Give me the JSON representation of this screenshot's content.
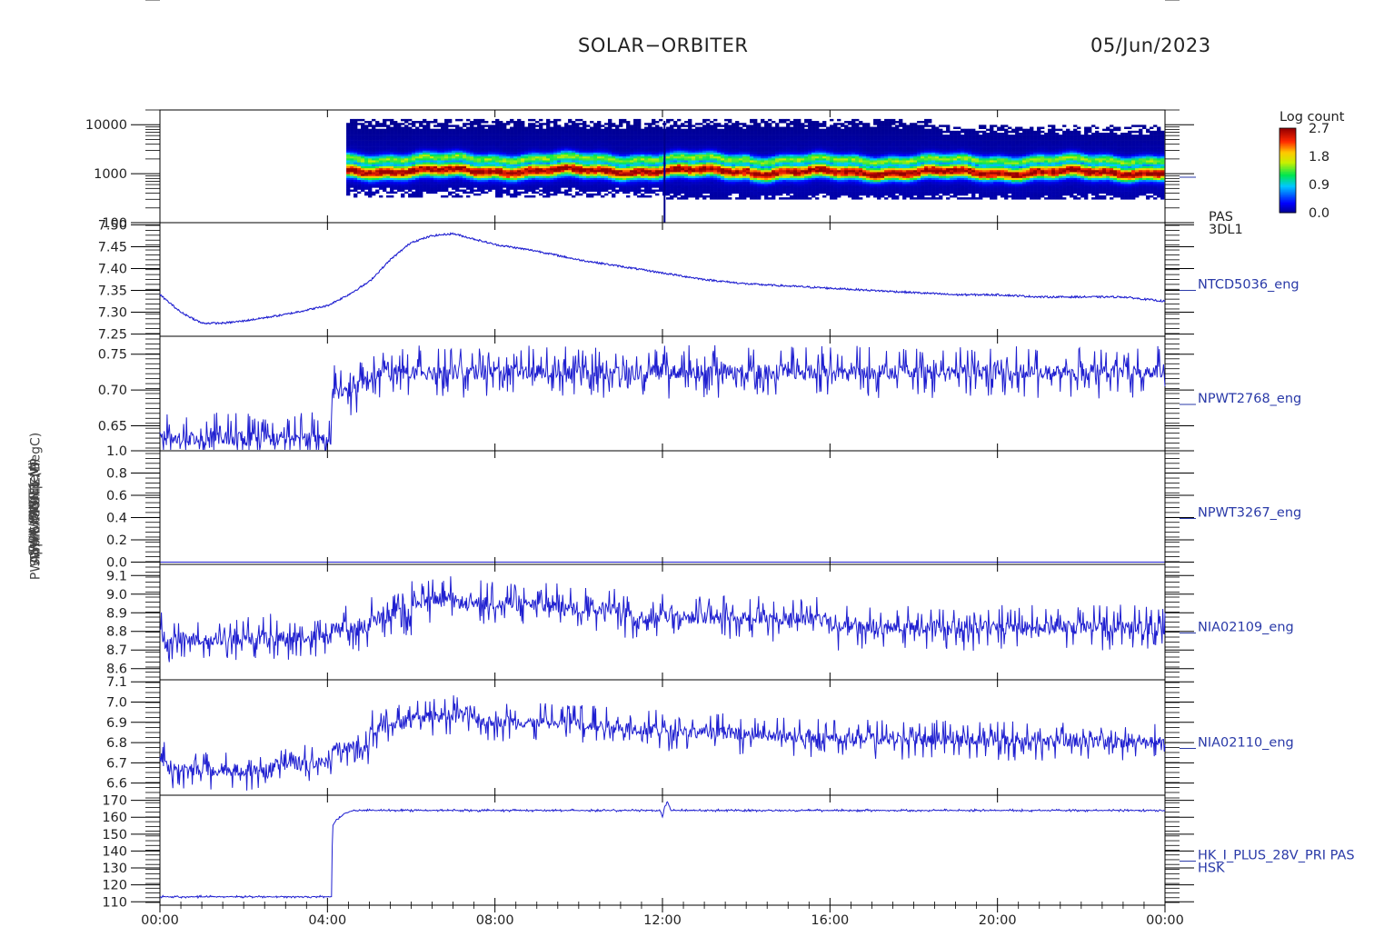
{
  "header": {
    "mission": "SOLAR−ORBITER",
    "date": "05/Jun/2023"
  },
  "colorbar": {
    "label": "Log count",
    "ticks": [
      "2.7",
      "1.8",
      "0.9",
      "0.0"
    ]
  },
  "x_axis": {
    "tick_labels": [
      "00:00",
      "04:00",
      "08:00",
      "12:00",
      "16:00",
      "20:00",
      "00:00"
    ]
  },
  "y_title_lines": [
    "SW E(eV)",
    "Approx Temp (DegC)",
    "RPW ANT 1 (A)",
    "SWA EAS 0 TEMP",
    "SWA PAS ...",
    "PWR HK IMON ..."
  ],
  "colors": {
    "line": "#1f1fd0",
    "axis": "#000000",
    "label": "#2a3aa8"
  },
  "chart_data": [
    {
      "type": "heatmap",
      "name": "PAS 3DL1",
      "right_labels": [
        "PAS",
        "3DL1"
      ],
      "y_scale": "log",
      "ylim": [
        100,
        20000
      ],
      "y_ticks": [
        "10000",
        "1000",
        "100"
      ],
      "data_start_hour": 4.45,
      "peak_energy_ev": 1100,
      "color_scale": {
        "label": "Log count",
        "min": 0.0,
        "max": 2.7
      }
    },
    {
      "type": "line",
      "name": "NTCD5036_eng",
      "right_labels": [
        "NTCD5036_eng"
      ],
      "ylim": [
        7.245,
        7.505
      ],
      "y_ticks": [
        "7.50",
        "7.45",
        "7.40",
        "7.35",
        "7.30",
        "7.25"
      ],
      "x": [
        0,
        0.5,
        1,
        1.5,
        2,
        3,
        4,
        4.5,
        5,
        5.5,
        6,
        6.5,
        7,
        8,
        9,
        10,
        11,
        12,
        13,
        14,
        15,
        16,
        17,
        18,
        19,
        20,
        21,
        22,
        23,
        24
      ],
      "y": [
        7.34,
        7.3,
        7.275,
        7.275,
        7.28,
        7.295,
        7.315,
        7.34,
        7.37,
        7.42,
        7.46,
        7.475,
        7.48,
        7.455,
        7.44,
        7.42,
        7.405,
        7.39,
        7.375,
        7.365,
        7.36,
        7.355,
        7.35,
        7.345,
        7.34,
        7.34,
        7.335,
        7.335,
        7.335,
        7.325
      ],
      "noise": 0.003
    },
    {
      "type": "line",
      "name": "NPWT2768_eng",
      "right_labels": [
        "NPWT2768_eng"
      ],
      "ylim": [
        0.615,
        0.775
      ],
      "y_ticks": [
        "0.75",
        "0.70",
        "0.65"
      ],
      "x": [
        0,
        4.1,
        4.1,
        4.5,
        5.0,
        5.2,
        24
      ],
      "y": [
        0.632,
        0.632,
        0.697,
        0.7,
        0.71,
        0.725,
        0.725
      ],
      "noise": 0.015
    },
    {
      "type": "line",
      "name": "NPWT3267_eng",
      "right_labels": [
        "NPWT3267_eng"
      ],
      "ylim": [
        -0.02,
        1.0
      ],
      "y_ticks": [
        "1.0",
        "0.8",
        "0.6",
        "0.4",
        "0.2",
        "0.0"
      ],
      "x": [
        0,
        24
      ],
      "y": [
        0.0,
        0.0
      ],
      "noise": 0
    },
    {
      "type": "line",
      "name": "NIA02109_eng",
      "right_labels": [
        "NIA02109_eng"
      ],
      "ylim": [
        8.54,
        9.16
      ],
      "y_ticks": [
        "9.1",
        "9.0",
        "8.9",
        "8.8",
        "8.7",
        "8.6"
      ],
      "x": [
        0,
        0.2,
        2.6,
        2.6,
        4.1,
        4.1,
        5.0,
        5.0,
        6.0,
        6.0,
        7.0,
        7.0,
        9.0,
        11.0,
        11.0,
        14.0,
        16.0,
        16.0,
        24
      ],
      "y": [
        8.82,
        8.76,
        8.76,
        8.77,
        8.77,
        8.82,
        8.82,
        8.87,
        8.9,
        8.96,
        8.98,
        8.96,
        8.94,
        8.92,
        8.88,
        8.87,
        8.87,
        8.82,
        8.82
      ],
      "noise": 0.05
    },
    {
      "type": "line",
      "name": "NIA02110_eng",
      "right_labels": [
        "NIA02110_eng"
      ],
      "ylim": [
        6.54,
        7.11
      ],
      "y_ticks": [
        "7.1",
        "7.0",
        "6.9",
        "6.8",
        "6.7",
        "6.6"
      ],
      "x": [
        0,
        0.2,
        2.6,
        2.6,
        4.1,
        4.1,
        5.0,
        5.0,
        6.0,
        6.0,
        7.5,
        7.5,
        10.0,
        12.0,
        14.0,
        16.0,
        24
      ],
      "y": [
        6.74,
        6.67,
        6.66,
        6.69,
        6.7,
        6.78,
        6.78,
        6.86,
        6.9,
        6.92,
        6.95,
        6.91,
        6.89,
        6.86,
        6.84,
        6.82,
        6.8
      ],
      "noise": 0.04
    },
    {
      "type": "line",
      "name": "HK_I_PLUS_28V_PRI PAS HSK",
      "right_labels": [
        "HK_I_PLUS_28V_PRI PAS",
        "HSK"
      ],
      "ylim": [
        108,
        173
      ],
      "y_ticks": [
        "170",
        "160",
        "150",
        "140",
        "130",
        "120",
        "110"
      ],
      "x": [
        0,
        4.1,
        4.12,
        4.2,
        4.4,
        4.6,
        4.8,
        11.95,
        12.0,
        12.05,
        12.12,
        12.2,
        24
      ],
      "y": [
        113,
        113,
        155,
        158,
        162,
        164,
        164,
        164,
        160,
        166,
        169,
        164,
        164
      ],
      "noise": 0.3
    }
  ]
}
